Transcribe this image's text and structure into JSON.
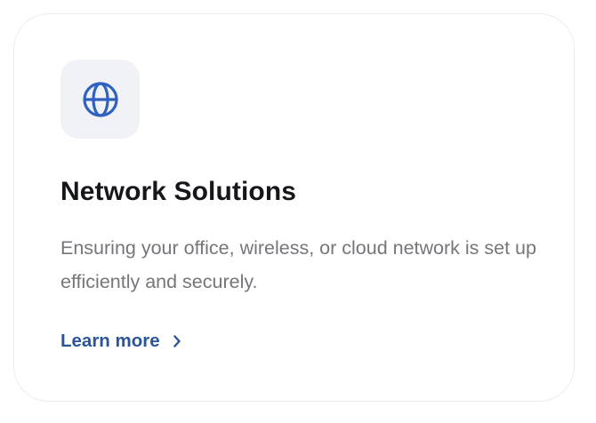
{
  "card": {
    "icon": "globe-icon",
    "title": "Network Solutions",
    "description": "Ensuring your office, wireless, or cloud network is set up efficiently and securely.",
    "link_label": "Learn more",
    "link_icon": "chevron-right-icon"
  },
  "colors": {
    "accent": "#2a5699",
    "icon_stroke": "#2f62c0",
    "icon_bg": "#f1f2f6",
    "title": "#16171b",
    "body_text": "#74767b",
    "card_border": "#ececef"
  }
}
